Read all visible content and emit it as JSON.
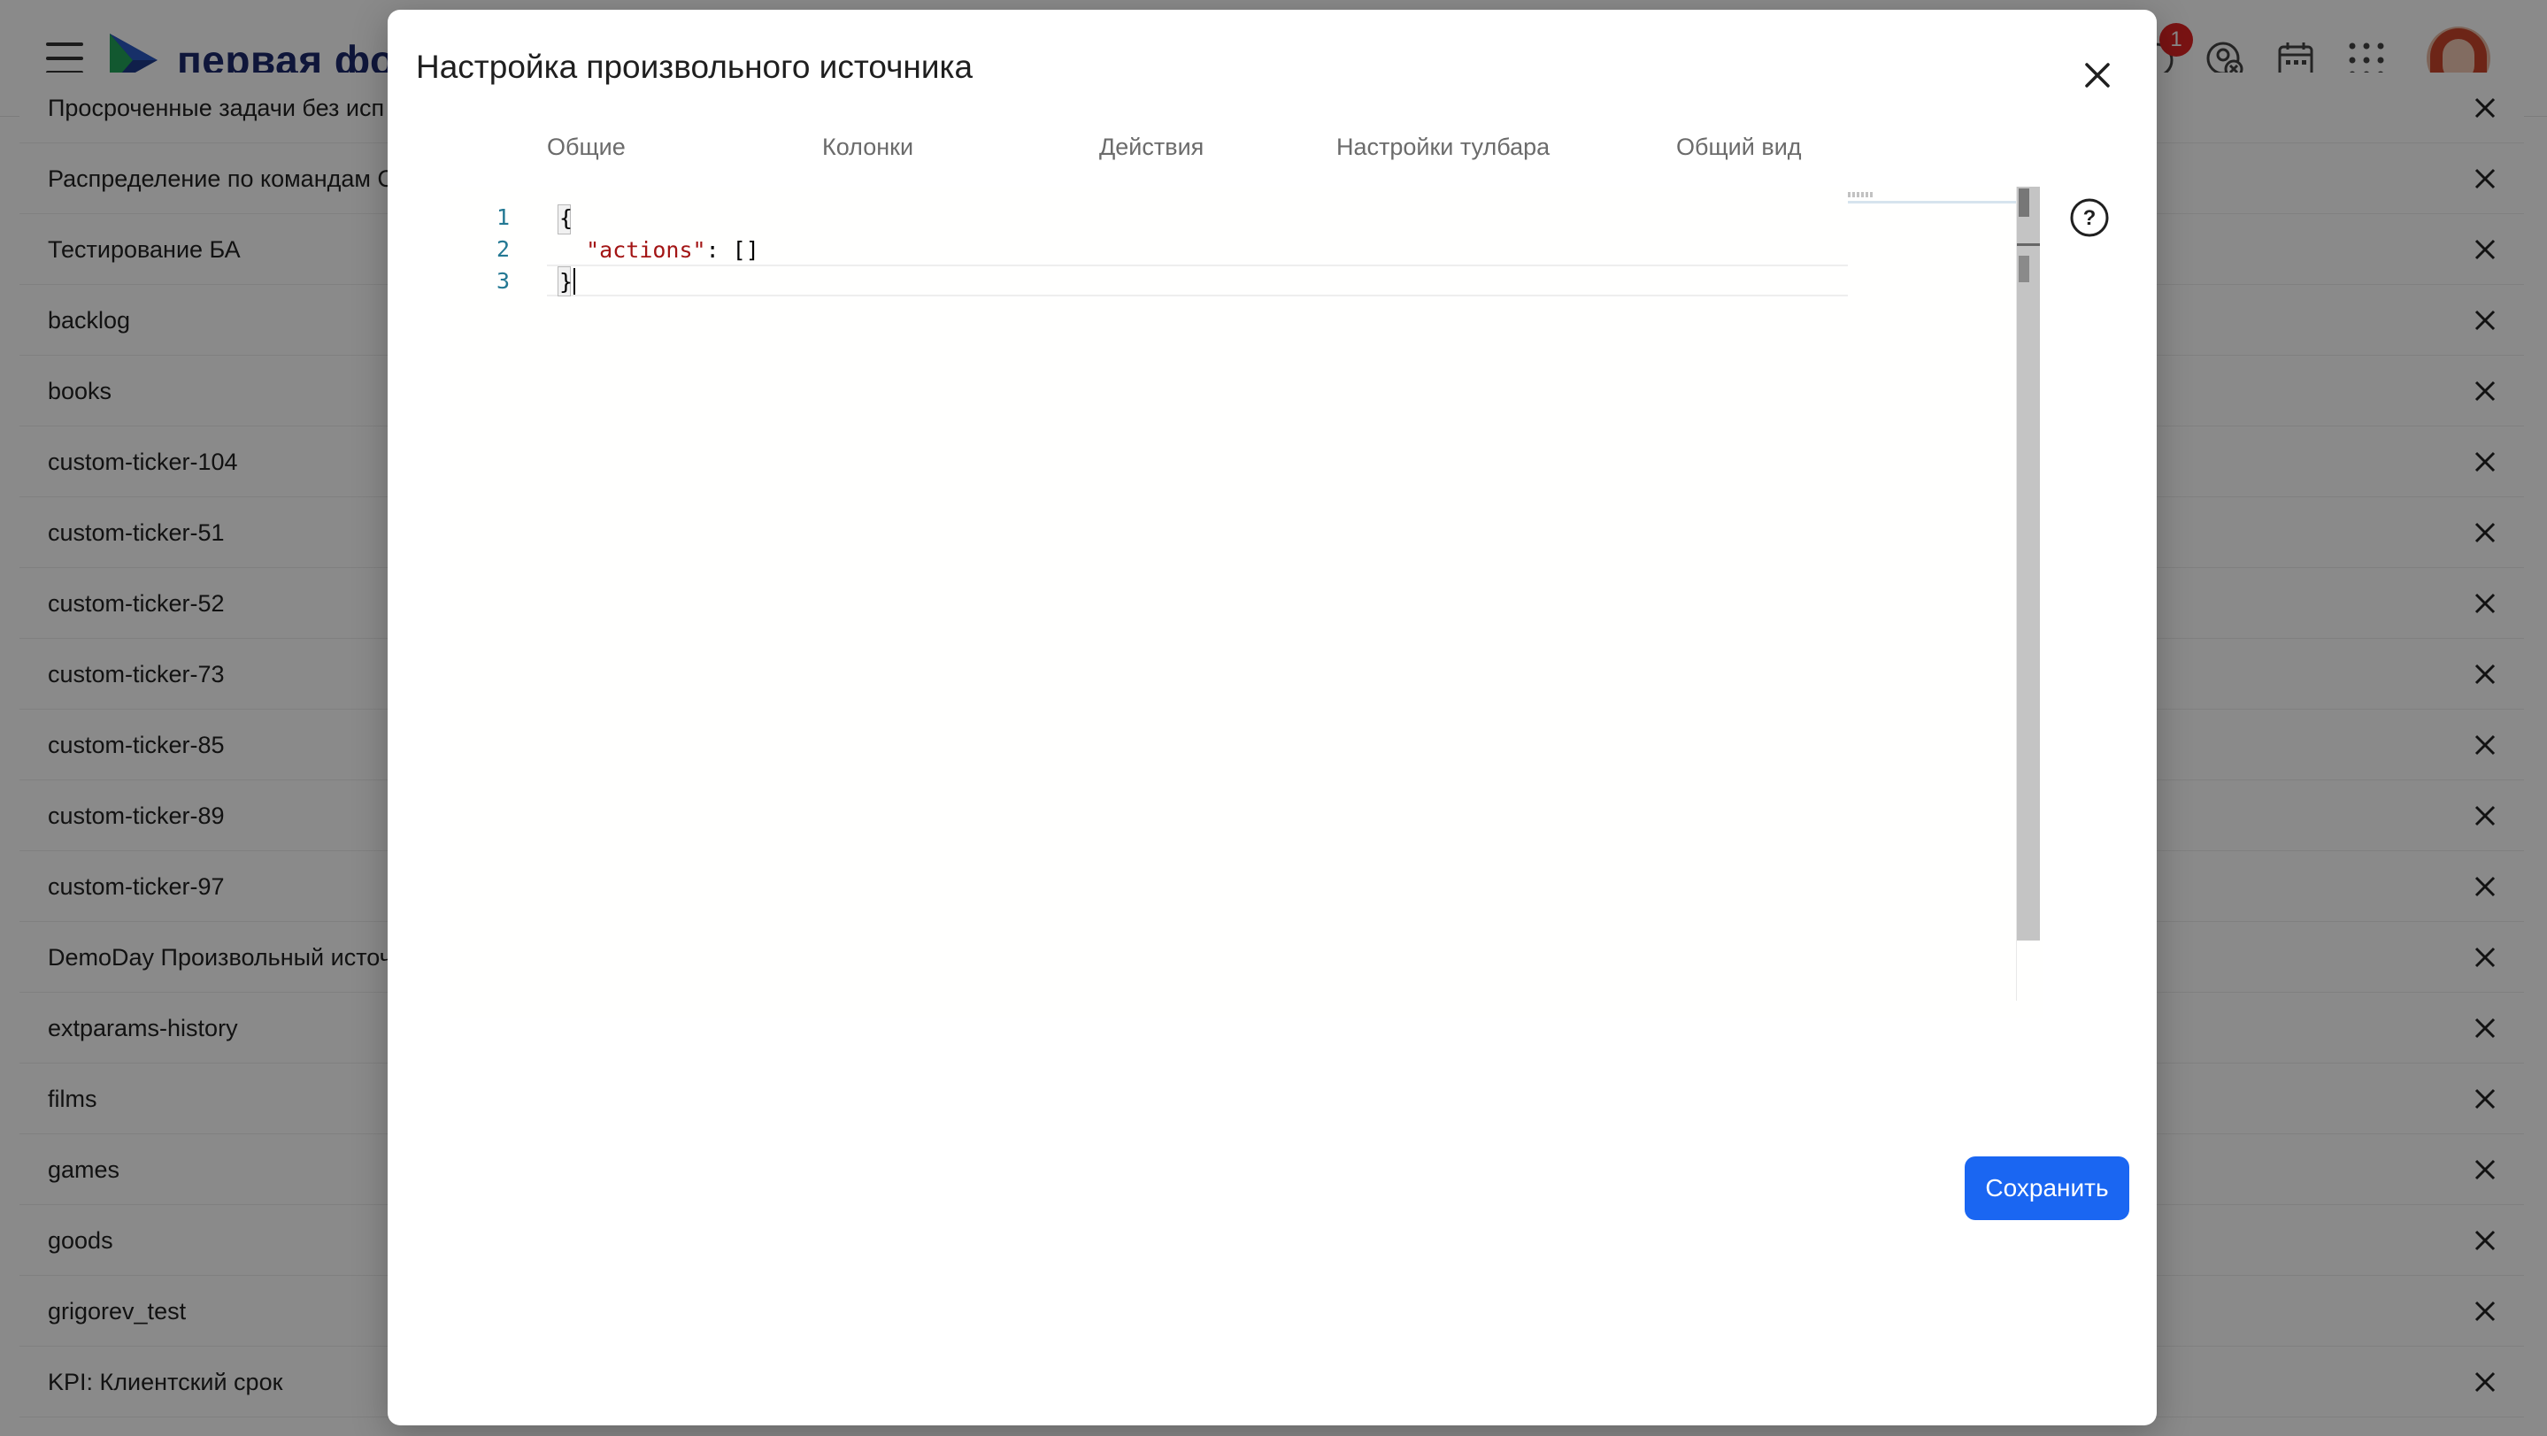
{
  "header": {
    "logo_text": "первая фор",
    "notification_count": "1"
  },
  "list": {
    "items": [
      "Просроченные задачи без исп",
      "Распределение по командам С",
      "Тестирование БА",
      "backlog",
      "books",
      "custom-ticker-104",
      "custom-ticker-51",
      "custom-ticker-52",
      "custom-ticker-73",
      "custom-ticker-85",
      "custom-ticker-89",
      "custom-ticker-97",
      "DemoDay Произвольный источ",
      "extparams-history",
      "films",
      "games",
      "goods",
      "grigorev_test",
      "KPI: Клиентский срок"
    ]
  },
  "modal": {
    "title": "Настройка произвольного источника",
    "tabs": [
      "Общие",
      "Колонки",
      "Действия",
      "Настройки тулбара",
      "Общий вид"
    ],
    "editor": {
      "line_numbers": [
        "1",
        "2",
        "3"
      ],
      "line1": "{",
      "line2_key": "\"actions\"",
      "line2_rest": ": []",
      "line3": "}"
    },
    "save_label": "Сохранить"
  },
  "colors": {
    "accent": "#1a66f2",
    "json_string": "#a31515",
    "line_number": "#237893",
    "badge": "#e02424"
  }
}
